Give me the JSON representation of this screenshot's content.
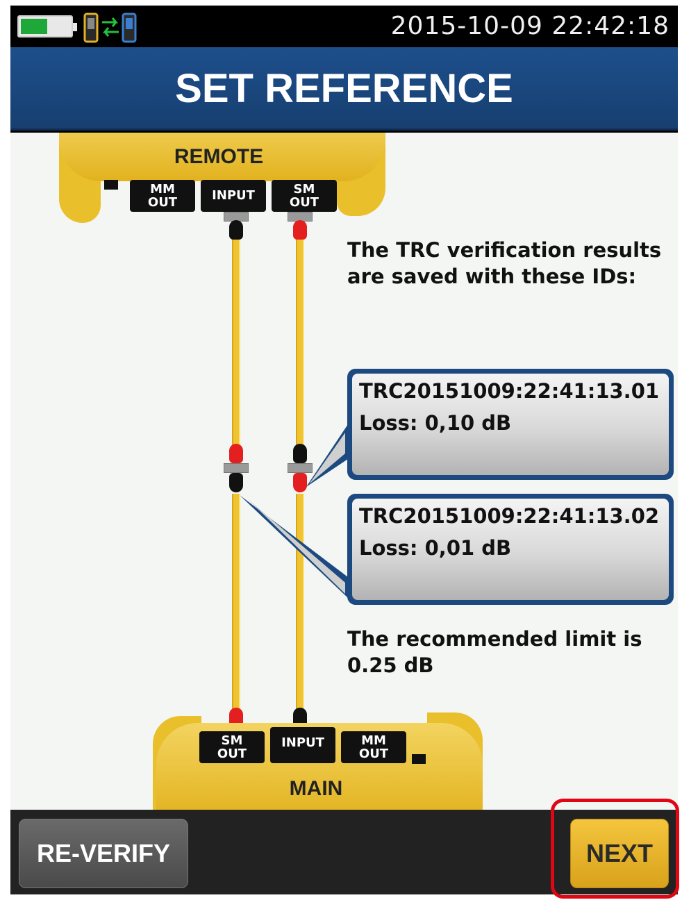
{
  "status_bar": {
    "datetime": "2015-10-09 22:42:18",
    "battery_icon": "battery-icon",
    "link_icon": "remote-link-icon"
  },
  "header": {
    "title": "SET REFERENCE"
  },
  "diagram": {
    "remote_label": "REMOTE",
    "main_label": "MAIN",
    "remote_ports": [
      {
        "line1": "MM",
        "line2": "OUT"
      },
      {
        "line1": "INPUT",
        "line2": ""
      },
      {
        "line1": "SM",
        "line2": "OUT"
      }
    ],
    "main_ports": [
      {
        "line1": "SM",
        "line2": "OUT"
      },
      {
        "line1": "INPUT",
        "line2": ""
      },
      {
        "line1": "MM",
        "line2": "OUT"
      }
    ],
    "info_text": "The TRC verification results are saved with these IDs:",
    "results": [
      {
        "id": "TRC20151009:22:41:13.01",
        "loss": "Loss: 0,10 dB"
      },
      {
        "id": "TRC20151009:22:41:13.02",
        "loss": "Loss: 0,01 dB"
      }
    ],
    "limit_text": "The recommended limit is 0.25 dB"
  },
  "footer": {
    "reverify_label": "RE-VERIFY",
    "next_label": "NEXT"
  },
  "colors": {
    "title_bar": "#1d4f8c",
    "cable": "#f0c332",
    "highlight": "#e10613",
    "next_button": "#f3c53d"
  }
}
